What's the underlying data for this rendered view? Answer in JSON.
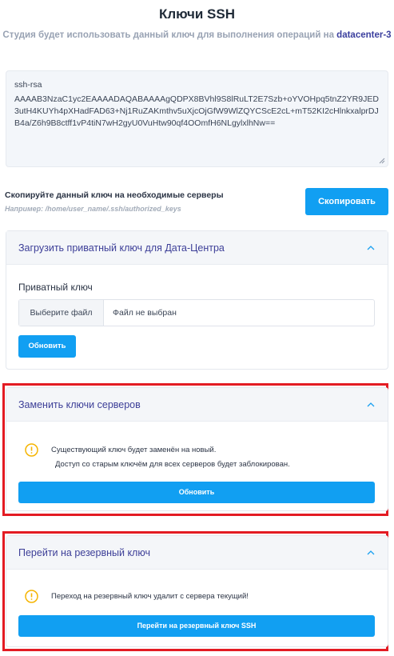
{
  "header": {
    "title": "Ключи SSH",
    "subtitle_prefix": "Студия будет использовать данный ключ для выполнения операций на",
    "datacenter": "datacenter-3"
  },
  "ssh_key": {
    "type": "ssh-rsa",
    "value": "AAAAB3NzaC1yc2EAAAADAQABAAAAgQDPX8BVhl9S8lRuLT2E7Szb+oYVOHpq5tnZ2YR9JED3utH4KUYh4pXHadFAD63+Nj1RuZAKmthv5uXjcOjGfW9WlZQYCScE2cL+mT52KI2cHlnkxalprDJB4a/Z6h9B8ctff1vP4tiN7wH2gyU0VuHtw90qf4OOmfH6NLgylxlhNw=="
  },
  "copy_section": {
    "label": "Скопируйте данный ключ на необходимые серверы",
    "hint": "Например: /home/user_name/.ssh/authorized_keys",
    "button": "Скопировать"
  },
  "upload_panel": {
    "title": "Загрузить приватный ключ для Дата-Центра",
    "field_label": "Приватный ключ",
    "file_button": "Выберите файл",
    "file_name": "Файл не выбран",
    "submit": "Обновить"
  },
  "replace_panel": {
    "title": "Заменить ключи серверов",
    "line1": "Существующий ключ будет заменён на новый.",
    "line2": "Доступ со старым ключём для всех серверов будет заблокирован.",
    "button": "Обновить"
  },
  "backup_panel": {
    "title": "Перейти на резервный ключ",
    "line1": "Переход на резервный ключ удалит с сервера текущий!",
    "button": "Перейти на резервный ключ SSH"
  },
  "colors": {
    "accent": "#119ff2",
    "panel_title": "#3d3f98",
    "highlight_frame": "#e31b23",
    "warning": "#f5b400"
  },
  "icons": {
    "chevron": "chevron-up-icon",
    "warning": "warning-circle-icon",
    "grip": "resize-grip-icon"
  }
}
